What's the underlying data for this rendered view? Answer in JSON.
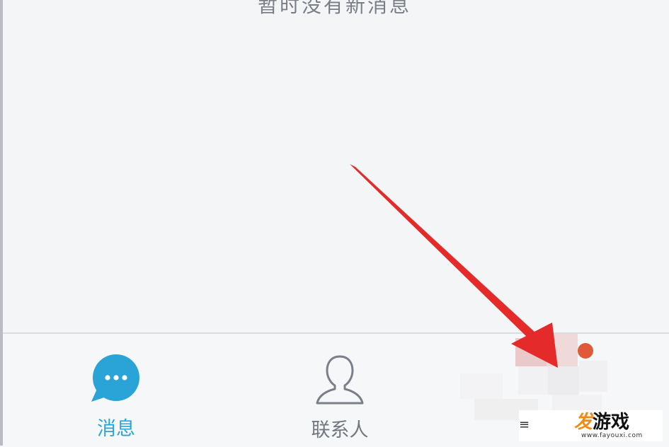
{
  "empty_message": "暂时没有新消息",
  "tabs": [
    {
      "label": "消息",
      "icon": "chat-bubble-icon",
      "active": true
    },
    {
      "label": "联系人",
      "icon": "person-icon",
      "active": false
    }
  ],
  "colors": {
    "active": "#2aa4d6",
    "inactive": "#717880",
    "badge": "#e05a3a",
    "arrow": "#e52a2a"
  },
  "watermark": {
    "logo_accent": "发",
    "logo_text": "游戏",
    "url": "www.fayouxi.com"
  }
}
